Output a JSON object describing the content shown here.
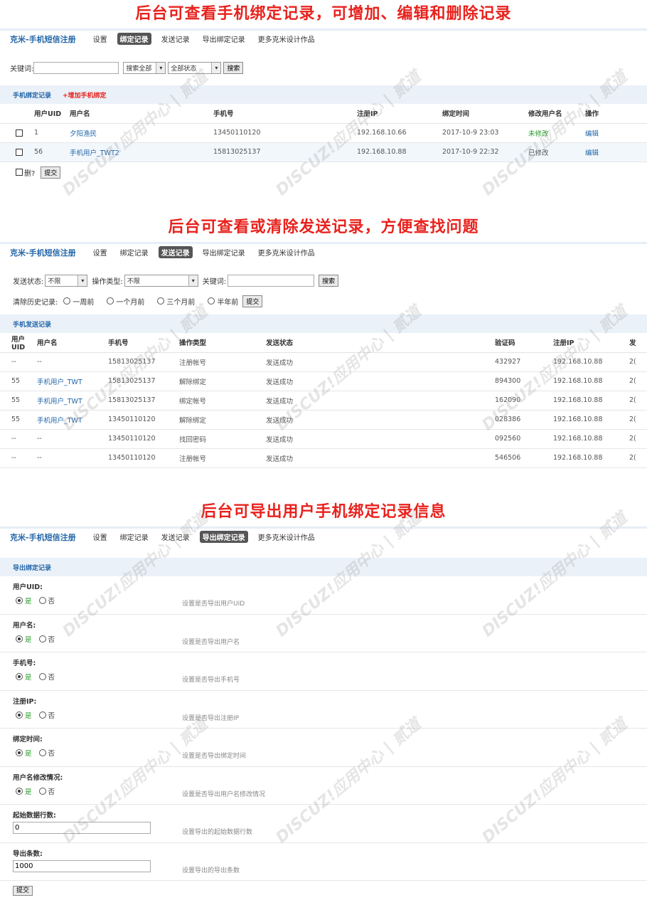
{
  "panel1": {
    "banner": "后台可查看手机绑定记录，可增加、编辑和删除记录",
    "app_title": "克米-手机短信注册",
    "nav": [
      "设置",
      "绑定记录",
      "发送记录",
      "导出绑定记录",
      "更多克米设计作品"
    ],
    "keyword_label": "关键词:",
    "keyword_value": "",
    "search_scope": "搜索全部",
    "status_filter": "全部状态",
    "search_button": "搜索",
    "section_title": "手机绑定记录",
    "add_link": "+增加手机绑定",
    "columns": [
      "用户UID",
      "用户名",
      "手机号",
      "注册IP",
      "绑定时间",
      "修改用户名",
      "操作"
    ],
    "rows": [
      {
        "uid": "1",
        "username": "夕阳渔民",
        "phone": "13450110120",
        "ip": "192.168.10.66",
        "time": "2017-10-9 23:03",
        "modified": "未修改",
        "action": "编辑"
      },
      {
        "uid": "56",
        "username": "手机用户_TWT2",
        "phone": "15813025137",
        "ip": "192.168.10.88",
        "time": "2017-10-9 22:32",
        "modified": "已修改",
        "action": "编辑"
      }
    ],
    "delete_label": "删?",
    "submit_button": "提交"
  },
  "panel2": {
    "banner": "后台可查看或清除发送记录，方便查找问题",
    "app_title": "克米-手机短信注册",
    "nav": [
      "设置",
      "绑定记录",
      "发送记录",
      "导出绑定记录",
      "更多克米设计作品"
    ],
    "send_status_label": "发送状态:",
    "send_status_value": "不限",
    "op_type_label": "操作类型:",
    "op_type_value": "不限",
    "keyword_label": "关键词:",
    "keyword_value": "",
    "search_button": "搜索",
    "clear_label": "清除历史记录:",
    "clear_options": [
      "一周前",
      "一个月前",
      "三个月前",
      "半年前"
    ],
    "clear_submit": "提交",
    "section_title": "手机发送记录",
    "columns": [
      "用户UID",
      "用户名",
      "手机号",
      "操作类型",
      "发送状态",
      "验证码",
      "注册IP",
      "发"
    ],
    "rows": [
      {
        "uid": "--",
        "username": "--",
        "phone": "15813025137",
        "type": "注册帐号",
        "status": "发送成功",
        "code": "432927",
        "ip": "192.168.10.88",
        "extra": "2("
      },
      {
        "uid": "55",
        "username": "手机用户_TWT",
        "phone": "15813025137",
        "type": "解除绑定",
        "status": "发送成功",
        "code": "894300",
        "ip": "192.168.10.88",
        "extra": "2("
      },
      {
        "uid": "55",
        "username": "手机用户_TWT",
        "phone": "15813025137",
        "type": "绑定帐号",
        "status": "发送成功",
        "code": "162090",
        "ip": "192.168.10.88",
        "extra": "2("
      },
      {
        "uid": "55",
        "username": "手机用户_TWT",
        "phone": "13450110120",
        "type": "解除绑定",
        "status": "发送成功",
        "code": "028386",
        "ip": "192.168.10.88",
        "extra": "2("
      },
      {
        "uid": "--",
        "username": "--",
        "phone": "13450110120",
        "type": "找回密码",
        "status": "发送成功",
        "code": "092560",
        "ip": "192.168.10.88",
        "extra": "2("
      },
      {
        "uid": "--",
        "username": "--",
        "phone": "13450110120",
        "type": "注册帐号",
        "status": "发送成功",
        "code": "546506",
        "ip": "192.168.10.88",
        "extra": "2("
      }
    ]
  },
  "panel3": {
    "banner": "后台可导出用户手机绑定记录信息",
    "app_title": "克米-手机短信注册",
    "nav": [
      "设置",
      "绑定记录",
      "发送记录",
      "导出绑定记录",
      "更多克米设计作品"
    ],
    "section_title": "导出绑定记录",
    "yes_label": "是",
    "no_label": "否",
    "fields": [
      {
        "label": "用户UID:",
        "desc": "设置是否导出用户UID"
      },
      {
        "label": "用户名:",
        "desc": "设置是否导出用户名"
      },
      {
        "label": "手机号:",
        "desc": "设置是否导出手机号"
      },
      {
        "label": "注册IP:",
        "desc": "设置是否导出注册IP"
      },
      {
        "label": "绑定时间:",
        "desc": "设置是否导出绑定时间"
      },
      {
        "label": "用户名修改情况:",
        "desc": "设置是否导出用户名修改情况"
      }
    ],
    "start_label": "起始数据行数:",
    "start_value": "0",
    "start_desc": "设置导出的起始数据行数",
    "count_label": "导出条数:",
    "count_value": "1000",
    "count_desc": "设置导出的导出条数",
    "submit_button": "提交"
  },
  "watermark_text": "DISCUZ!应用中心 | 贰道"
}
